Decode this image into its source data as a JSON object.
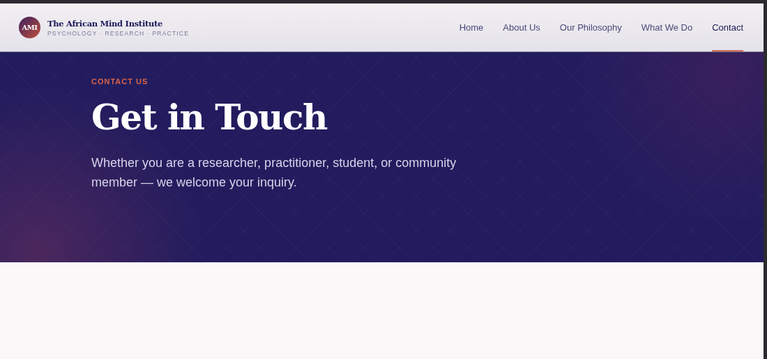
{
  "brand": {
    "logo": "AMI",
    "name": "The African Mind Institute",
    "tagline": "PSYCHOLOGY · RESEARCH · PRACTICE"
  },
  "nav": [
    {
      "label": "Home",
      "selected": false
    },
    {
      "label": "About Us",
      "selected": false
    },
    {
      "label": "Our Philosophy",
      "selected": false
    },
    {
      "label": "What We Do",
      "selected": false
    },
    {
      "label": "Contact",
      "selected": true
    }
  ],
  "hero": {
    "eyebrow": "CONTACT US",
    "title": "Get in Touch",
    "text": "Whether you are a researcher, practitioner, student, or community member — we welcome your inquiry."
  }
}
